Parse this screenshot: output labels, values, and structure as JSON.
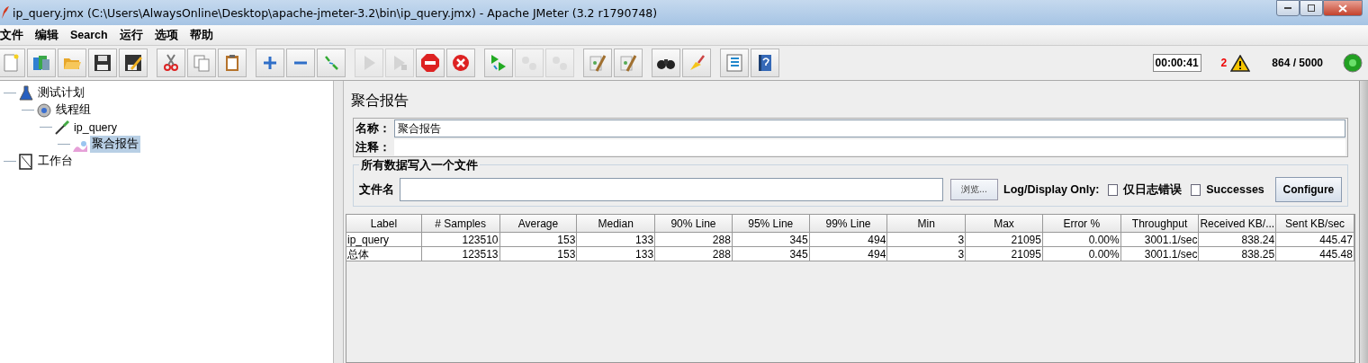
{
  "window": {
    "title": "ip_query.jmx (C:\\Users\\AlwaysOnline\\Desktop\\apache-jmeter-3.2\\bin\\ip_query.jmx) - Apache JMeter (3.2 r1790748)"
  },
  "menu": [
    "文件",
    "编辑",
    "Search",
    "运行",
    "选项",
    "帮助"
  ],
  "toolbar": [
    [
      {
        "kind": "new",
        "disabled": false
      },
      {
        "kind": "templates",
        "disabled": false
      },
      {
        "kind": "open",
        "disabled": false
      },
      {
        "kind": "save",
        "disabled": false
      },
      {
        "kind": "saveas",
        "disabled": false
      }
    ],
    [
      {
        "kind": "cut",
        "disabled": false
      },
      {
        "kind": "copy",
        "disabled": false
      },
      {
        "kind": "paste",
        "disabled": false
      }
    ],
    [
      {
        "kind": "expand",
        "disabled": false
      },
      {
        "kind": "collapse",
        "disabled": false
      },
      {
        "kind": "toggle",
        "disabled": false
      }
    ],
    [
      {
        "kind": "start",
        "disabled": true
      },
      {
        "kind": "startnopause",
        "disabled": true
      },
      {
        "kind": "stop",
        "disabled": false
      },
      {
        "kind": "shutdown",
        "disabled": false
      }
    ],
    [
      {
        "kind": "remotestart",
        "disabled": false
      },
      {
        "kind": "remotestop",
        "disabled": true
      },
      {
        "kind": "remoteexit",
        "disabled": true
      }
    ],
    [
      {
        "kind": "clear",
        "disabled": false
      },
      {
        "kind": "clearall",
        "disabled": false
      }
    ],
    [
      {
        "kind": "search",
        "disabled": false
      },
      {
        "kind": "reset",
        "disabled": false
      }
    ],
    [
      {
        "kind": "functions",
        "disabled": false
      },
      {
        "kind": "help",
        "disabled": false
      }
    ]
  ],
  "status": {
    "elapsed": "00:00:41",
    "errors": "2",
    "threads": "864 / 5000",
    "running": true
  },
  "tree": [
    {
      "label": "测试计划",
      "kind": "plan",
      "selected": false,
      "children": [
        {
          "label": "线程组",
          "kind": "threads",
          "selected": false,
          "children": [
            {
              "label": "ip_query",
              "kind": "sampler",
              "selected": false,
              "children": [
                {
                  "label": "聚合报告",
                  "kind": "report",
                  "selected": true
                }
              ]
            }
          ]
        }
      ]
    },
    {
      "label": "工作台",
      "kind": "workbench",
      "selected": false
    }
  ],
  "panel": {
    "title": "聚合报告",
    "name_label": "名称：",
    "name_value": "聚合报告",
    "comment_label": "注释：",
    "file_group": {
      "title": "所有数据写入一个文件",
      "file_label": "文件名",
      "browse": "浏览...",
      "log_label": "Log/Display Only:",
      "options": [
        {
          "label": "仅日志错误",
          "checked": false
        },
        {
          "label": "Successes",
          "checked": false
        }
      ],
      "configure": "Configure"
    }
  },
  "table": {
    "columns": [
      "Label",
      "# Samples",
      "Average",
      "Median",
      "90% Line",
      "95% Line",
      "99% Line",
      "Min",
      "Max",
      "Error %",
      "Throughput",
      "Received KB/...",
      "Sent KB/sec"
    ],
    "rows": [
      [
        "ip_query",
        "123510",
        "153",
        "133",
        "288",
        "345",
        "494",
        "3",
        "21095",
        "0.00%",
        "3001.1/sec",
        "838.24",
        "445.47"
      ],
      [
        "总体",
        "123513",
        "153",
        "133",
        "288",
        "345",
        "494",
        "3",
        "21095",
        "0.00%",
        "3001.1/sec",
        "838.25",
        "445.48"
      ]
    ]
  }
}
